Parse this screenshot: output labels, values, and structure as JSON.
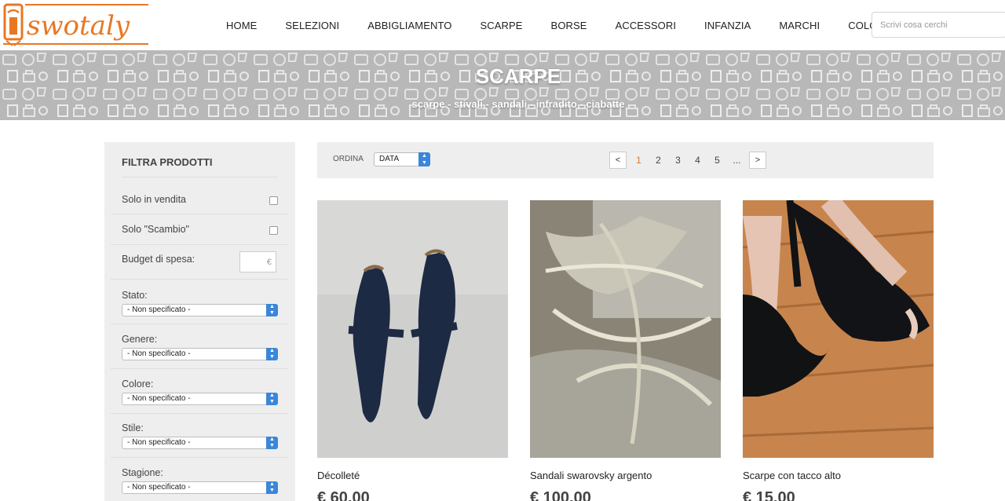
{
  "header": {
    "logo_text": "swotaly",
    "nav": [
      "HOME",
      "SELEZIONI",
      "ABBIGLIAMENTO",
      "SCARPE",
      "BORSE",
      "ACCESSORI",
      "INFANZIA",
      "MARCHI",
      "COLORI"
    ],
    "search_placeholder": "Scrivi cosa cerchi"
  },
  "banner": {
    "title": "SCARPE",
    "subtitle": "scarpe - stivali - sandali - infradito - ciabatte"
  },
  "filters": {
    "title": "FILTRA PRODOTTI",
    "solo_vendita": "Solo in vendita",
    "solo_scambio": "Solo \"Scambio\"",
    "budget_label": "Budget di spesa:",
    "budget_currency": "€",
    "selects": [
      {
        "label": "Stato:",
        "value": "- Non specificato -"
      },
      {
        "label": "Genere:",
        "value": "- Non specificato -"
      },
      {
        "label": "Colore:",
        "value": "- Non specificato -"
      },
      {
        "label": "Stile:",
        "value": "- Non specificato -"
      },
      {
        "label": "Stagione:",
        "value": "- Non specificato -"
      }
    ]
  },
  "toolbar": {
    "ordina_label": "ORDINA",
    "ordina_value": "DATA",
    "pager": {
      "prev": "<",
      "pages": [
        "1",
        "2",
        "3",
        "4",
        "5",
        "..."
      ],
      "current": "1",
      "next": ">"
    }
  },
  "products": [
    {
      "name": "Décolleté",
      "price": "€ 60,00"
    },
    {
      "name": "Sandali swarovsky argento",
      "price": "€ 100,00"
    },
    {
      "name": "Scarpe con tacco alto",
      "price": "€ 15,00"
    }
  ],
  "colors": {
    "brand": "#e87722",
    "accent_blue": "#3b86d9",
    "panel_bg": "#eeeeee"
  }
}
